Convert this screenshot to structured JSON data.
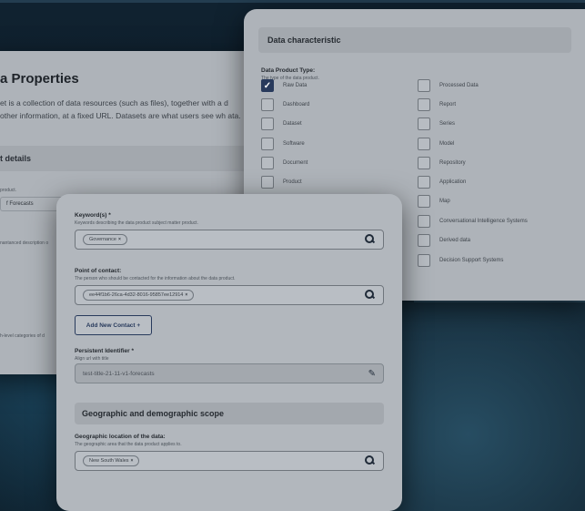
{
  "properties": {
    "title": "a Properties",
    "description": "et is a collection of data resources (such as files), together with a d other information, at a fixed URL. Datasets are what users see wh ata.",
    "section": "t details",
    "hint1": "product.",
    "field1_value": "f  Forecasts",
    "hint2": "nantanced description o",
    "hint3": "h-level categories of d"
  },
  "data_characteristic": {
    "header": "Data characteristic",
    "label": "Data Product Type:",
    "sublabel": "The type of the data product.",
    "options_left": [
      {
        "label": "Raw Data",
        "checked": true
      },
      {
        "label": "Dashboard",
        "checked": false
      },
      {
        "label": "Dataset",
        "checked": false
      },
      {
        "label": "Software",
        "checked": false
      },
      {
        "label": "Document",
        "checked": false
      },
      {
        "label": "Product",
        "checked": false
      }
    ],
    "options_right": [
      {
        "label": "Processed Data",
        "checked": false
      },
      {
        "label": "Report",
        "checked": false
      },
      {
        "label": "Series",
        "checked": false
      },
      {
        "label": "Model",
        "checked": false
      },
      {
        "label": "Repository",
        "checked": false
      },
      {
        "label": "Application",
        "checked": false
      },
      {
        "label": "Map",
        "checked": false
      },
      {
        "label": "Conversational Intelligence Systems",
        "checked": false
      },
      {
        "label": "Derived data",
        "checked": false
      },
      {
        "label": "Decision Support Systems",
        "checked": false
      }
    ]
  },
  "keywords": {
    "label": "Keyword(s) *",
    "sublabel": "Keywords describing the data product subject matter product.",
    "chip": "Governance"
  },
  "contact": {
    "label": "Point of contact:",
    "sublabel": "The person who should be contacted for the information about the data product.",
    "chip": "ee44f1b6-26ca-4d32-8016-95857ee12914",
    "add_button": "Add New Contact +"
  },
  "persistent": {
    "label": "Persistent Identifier *",
    "sublabel": "Align url with title",
    "value": "test-title-21-11-v1-forecasts"
  },
  "geo": {
    "section": "Geographic and demographic scope",
    "label": "Geographic location of the data:",
    "sublabel": "The geographic area that the data product applies to.",
    "chip": "New South Wales"
  },
  "icons": {
    "search": "search-icon",
    "edit": "pencil-icon",
    "check": "check-icon",
    "remove": "close-icon"
  }
}
